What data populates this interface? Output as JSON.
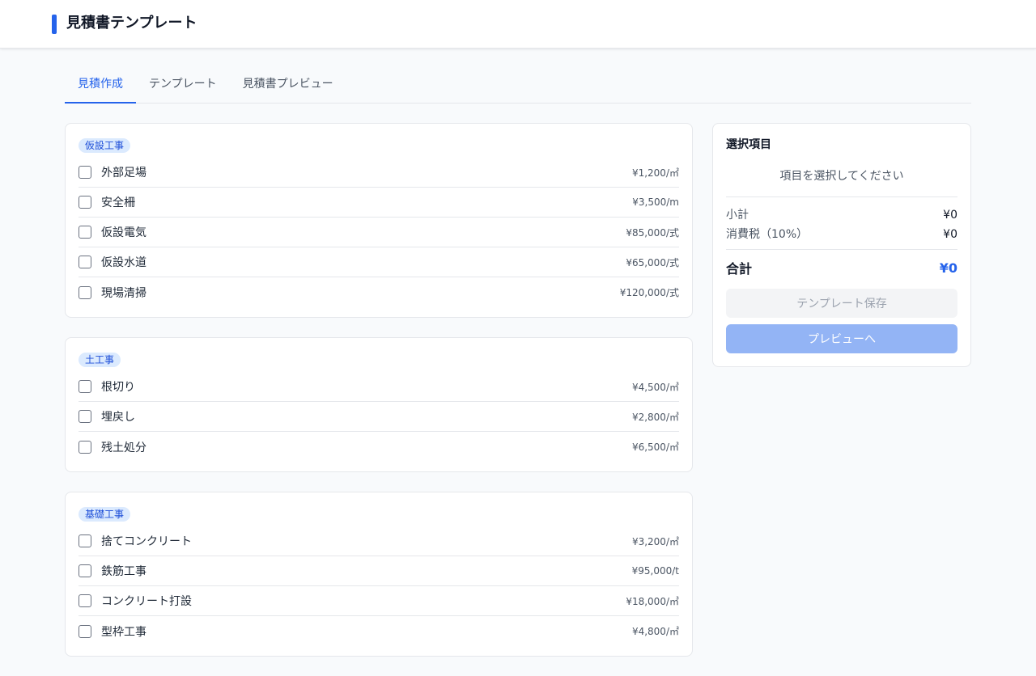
{
  "header": {
    "title": "見積書テンプレート"
  },
  "tabs": [
    {
      "label": "見積作成",
      "active": true
    },
    {
      "label": "テンプレート",
      "active": false
    },
    {
      "label": "見積書プレビュー",
      "active": false
    }
  ],
  "categories": [
    {
      "name": "仮設工事",
      "items": [
        {
          "name": "外部足場",
          "price": "¥1,200/㎡",
          "checked": false
        },
        {
          "name": "安全柵",
          "price": "¥3,500/m",
          "checked": false
        },
        {
          "name": "仮設電気",
          "price": "¥85,000/式",
          "checked": false
        },
        {
          "name": "仮設水道",
          "price": "¥65,000/式",
          "checked": false
        },
        {
          "name": "現場清掃",
          "price": "¥120,000/式",
          "checked": false
        }
      ]
    },
    {
      "name": "土工事",
      "items": [
        {
          "name": "根切り",
          "price": "¥4,500/㎥",
          "checked": false
        },
        {
          "name": "埋戻し",
          "price": "¥2,800/㎥",
          "checked": false
        },
        {
          "name": "残土処分",
          "price": "¥6,500/㎥",
          "checked": false
        }
      ]
    },
    {
      "name": "基礎工事",
      "items": [
        {
          "name": "捨てコンクリート",
          "price": "¥3,200/㎡",
          "checked": false
        },
        {
          "name": "鉄筋工事",
          "price": "¥95,000/t",
          "checked": false
        },
        {
          "name": "コンクリート打設",
          "price": "¥18,000/㎥",
          "checked": false
        },
        {
          "name": "型枠工事",
          "price": "¥4,800/㎡",
          "checked": false
        }
      ]
    }
  ],
  "summary": {
    "title": "選択項目",
    "empty_message": "項目を選択してください",
    "subtotal_label": "小計",
    "subtotal_value": "¥0",
    "tax_label": "消費税（10%）",
    "tax_value": "¥0",
    "total_label": "合計",
    "total_value": "¥0",
    "save_button": "テンプレート保存",
    "preview_button": "プレビューへ"
  },
  "colors": {
    "accent": "#2563eb",
    "badge_bg": "#dbeafe",
    "disabled_preview": "#93b4f5"
  }
}
